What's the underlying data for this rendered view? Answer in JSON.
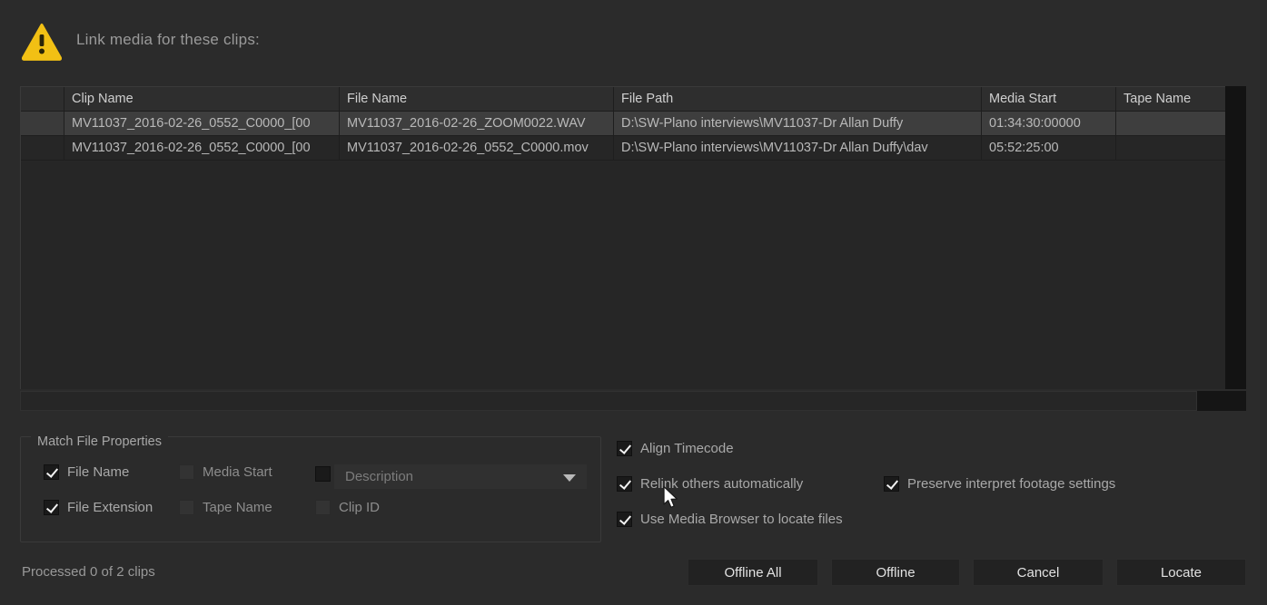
{
  "header": {
    "icon": "warning-triangle-icon",
    "title": "Link media for these clips:",
    "accent_color": "#f2c014"
  },
  "table": {
    "columns": [
      {
        "key": "idx",
        "label": ""
      },
      {
        "key": "clip_name",
        "label": "Clip Name"
      },
      {
        "key": "file_name",
        "label": "File Name"
      },
      {
        "key": "file_path",
        "label": "File Path"
      },
      {
        "key": "media_start",
        "label": "Media Start"
      },
      {
        "key": "tape_name",
        "label": "Tape Name"
      }
    ],
    "rows": [
      {
        "selected": true,
        "idx": "",
        "clip_name": "MV11037_2016-02-26_0552_C0000_[00",
        "file_name": "MV11037_2016-02-26_ZOOM0022.WAV",
        "file_path": "D:\\SW-Plano interviews\\MV11037-Dr Allan Duffy",
        "media_start": "01:34:30:00000",
        "tape_name": ""
      },
      {
        "selected": false,
        "idx": "",
        "clip_name": "MV11037_2016-02-26_0552_C0000_[00",
        "file_name": "MV11037_2016-02-26_0552_C0000.mov",
        "file_path": "D:\\SW-Plano interviews\\MV11037-Dr Allan Duffy\\dav",
        "media_start": "05:52:25:00",
        "tape_name": ""
      }
    ]
  },
  "match_group": {
    "title": "Match File Properties",
    "checkboxes": [
      {
        "label": "File Name",
        "checked": true,
        "dim": false
      },
      {
        "label": "Media Start",
        "checked": false,
        "dim": true
      },
      {
        "label": "File Extension",
        "checked": true,
        "dim": false
      },
      {
        "label": "Tape Name",
        "checked": false,
        "dim": true
      },
      {
        "label": "Clip ID",
        "checked": false,
        "dim": false
      }
    ],
    "metadata_dropdown": {
      "value": "Description",
      "arrow_icon": "chevron-down-icon"
    },
    "metadata_checkbox": {
      "label": "",
      "checked": false
    }
  },
  "options": [
    {
      "label": "Align Timecode",
      "checked": true
    },
    {
      "label": "Relink others automatically",
      "checked": true
    },
    {
      "label": "Preserve interpret footage settings",
      "checked": true
    },
    {
      "label": "Use Media Browser to locate files",
      "checked": true
    }
  ],
  "footer": {
    "status": "Processed 0 of 2 clips",
    "buttons": [
      {
        "label": "Offline All"
      },
      {
        "label": "Offline"
      },
      {
        "label": "Cancel"
      },
      {
        "label": "Locate"
      }
    ]
  }
}
